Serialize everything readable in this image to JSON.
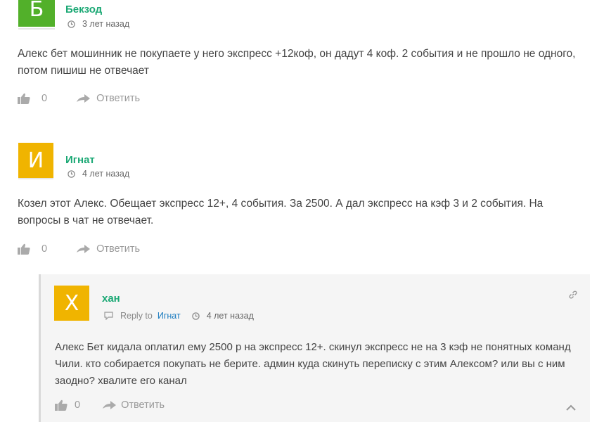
{
  "comments": [
    {
      "avatar_letter": "Б",
      "avatar_color": "#52b02a",
      "author": "Бекзод",
      "time": "3 лет назад",
      "text": "Алекс бет мошинник не покупаете у него экспресс +12коф, он дадут 4 коф. 2 события и не прошло не одного, потом пишиш не отвечает",
      "likes": "0",
      "reply_label": "Ответить"
    },
    {
      "avatar_letter": "И",
      "avatar_color": "#f0b400",
      "author": "Игнат",
      "time": "4 лет назад",
      "text": "Козел этот Алекс. Обещает экспресс 12+, 4 события. За 2500. А дал экспресс на кэф 3 и 2 события. На вопросы в чат не отвечает.",
      "likes": "0",
      "reply_label": "Ответить"
    }
  ],
  "reply": {
    "avatar_letter": "Х",
    "avatar_color": "#f0b400",
    "author": "хан",
    "reply_to_label": "Reply to",
    "reply_to_name": "Игнат",
    "time": "4 лет назад",
    "text": "Алекс Бет кидала оплатил ему 2500 р на экспресс 12+. скинул экспресс не на 3 кэф не понятных команд Чили. кто собирается покупать не берите. админ куда скинуть переписку с этим Алексом? или вы с ним заодно? хвалите его канал",
    "likes": "0",
    "reply_label": "Ответить"
  },
  "colors": {
    "accent": "#1aa874",
    "link": "#1a7bbf",
    "muted": "#999999"
  }
}
